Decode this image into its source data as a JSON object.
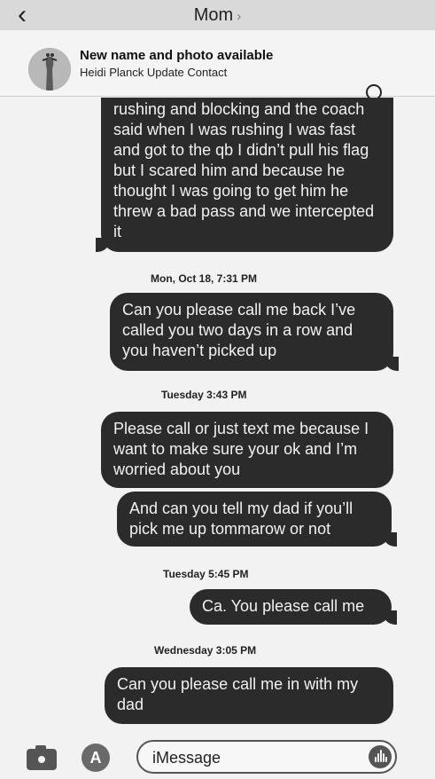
{
  "header": {
    "back_icon": "chevron-left-icon",
    "contact_name": "Mom",
    "chevron": "›"
  },
  "banner": {
    "title": "New name and photo available",
    "subtitle": "Heidi Planck Update Contact",
    "close_icon": "⊗"
  },
  "messages": [
    {
      "text": "rushing and blocking and the coach said when I was rushing I was fast and got to the qb I didn’t pull his flag but I scared him and because he thought I was going to get him he threw a bad pass and we intercepted it"
    },
    {
      "text": "Can you please call me back I’ve called you two days in a row and you haven’t picked up"
    },
    {
      "text": "Please call or just text me because I want to make sure your ok and I’m worried about you"
    },
    {
      "text": "And can you tell my dad if you’ll pick me up tommarow or not"
    },
    {
      "text": "Ca. You please call me"
    },
    {
      "text": "Can you please call me in with my dad"
    }
  ],
  "timestamps": [
    "Mon, Oct 18, 7:31 PM",
    "Tuesday 3:43 PM",
    "Tuesday 5:45 PM",
    "Wednesday 3:05 PM"
  ],
  "composer": {
    "placeholder": "iMessage",
    "appstore_glyph": "A"
  },
  "colors": {
    "bubble": "#2b2b2b",
    "background": "#f2f2f2",
    "header": "#d9d9d9"
  }
}
